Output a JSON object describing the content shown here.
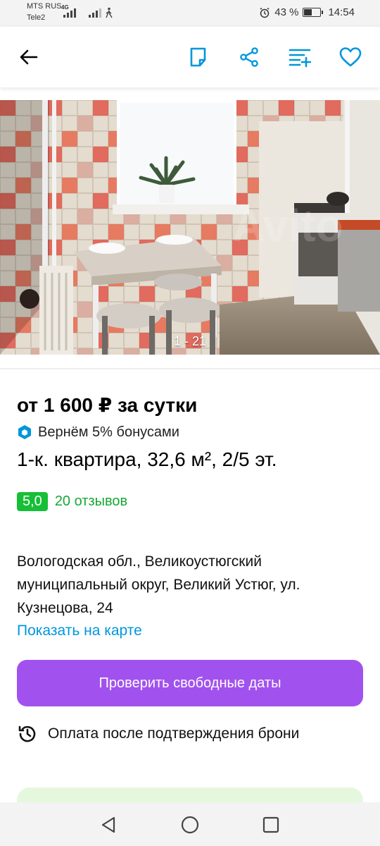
{
  "status_bar": {
    "carrier_1": "MTS RUS",
    "carrier_2": "Tele2",
    "network": "4G",
    "battery": "43 %",
    "time": "14:54"
  },
  "header": {
    "icons": [
      "back-arrow-icon",
      "note-icon",
      "share-icon",
      "compare-icon",
      "heart-icon"
    ],
    "accent": "#0096dc"
  },
  "gallery": {
    "counter": "1 - 21"
  },
  "listing": {
    "price": "от 1 600 ₽ за сутки",
    "bonus": "Вернём 5% бонусами",
    "title": "1-к. квартира, 32,6 м², 2/5 эт.",
    "rating": "5,0",
    "reviews": "20 отзывов",
    "address": "Вологодская обл., Великоустюгский муниципальный округ, Великий Устюг, ул. Кузнецова, 24",
    "map_link": "Показать на карте",
    "cta": "Проверить свободные даты",
    "payment_note": "Оплата после подтверждения брони"
  },
  "colors": {
    "cta": "#a152ee",
    "rating_badge": "#16bf36",
    "link": "#0096dc"
  }
}
